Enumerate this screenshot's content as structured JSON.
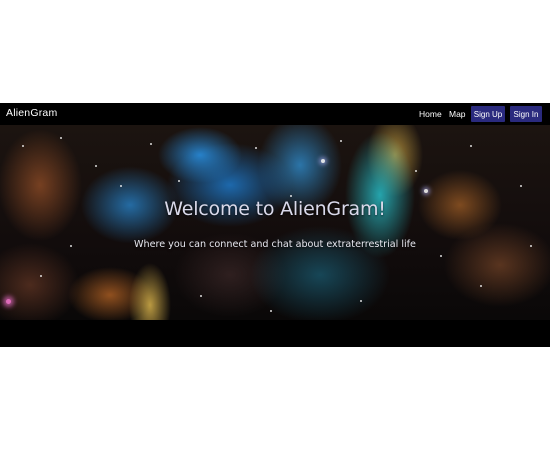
{
  "navbar": {
    "brand": "AlienGram",
    "links": {
      "home": "Home",
      "map": "Map"
    },
    "buttons": {
      "sign_up": "Sign Up",
      "sign_in": "Sign In"
    },
    "button_color": "#2a2a7e"
  },
  "hero": {
    "title": "Welcome to AlienGram!",
    "subtitle": "Where you can connect and chat about extraterrestrial life"
  }
}
